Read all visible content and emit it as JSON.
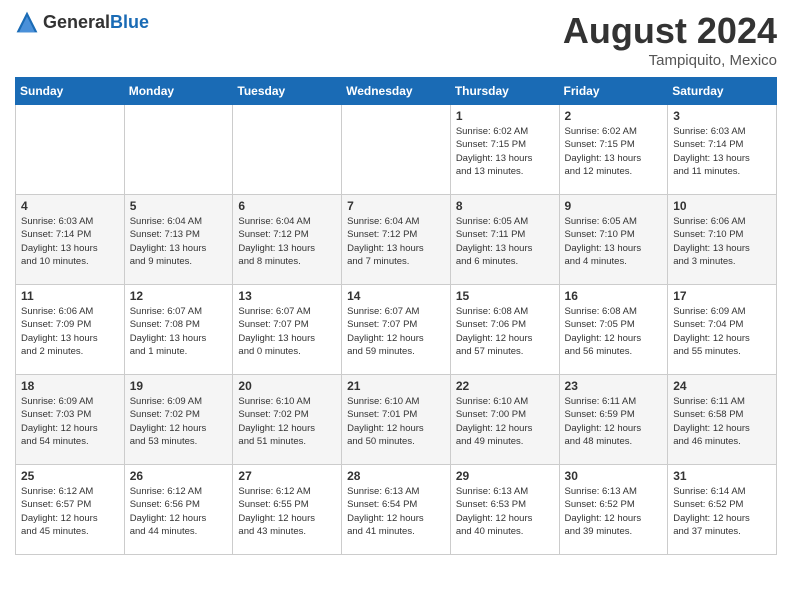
{
  "header": {
    "logo_general": "General",
    "logo_blue": "Blue",
    "month_year": "August 2024",
    "location": "Tampiquito, Mexico"
  },
  "calendar": {
    "days_of_week": [
      "Sunday",
      "Monday",
      "Tuesday",
      "Wednesday",
      "Thursday",
      "Friday",
      "Saturday"
    ],
    "weeks": [
      [
        {
          "day": "",
          "info": ""
        },
        {
          "day": "",
          "info": ""
        },
        {
          "day": "",
          "info": ""
        },
        {
          "day": "",
          "info": ""
        },
        {
          "day": "1",
          "info": "Sunrise: 6:02 AM\nSunset: 7:15 PM\nDaylight: 13 hours\nand 13 minutes."
        },
        {
          "day": "2",
          "info": "Sunrise: 6:02 AM\nSunset: 7:15 PM\nDaylight: 13 hours\nand 12 minutes."
        },
        {
          "day": "3",
          "info": "Sunrise: 6:03 AM\nSunset: 7:14 PM\nDaylight: 13 hours\nand 11 minutes."
        }
      ],
      [
        {
          "day": "4",
          "info": "Sunrise: 6:03 AM\nSunset: 7:14 PM\nDaylight: 13 hours\nand 10 minutes."
        },
        {
          "day": "5",
          "info": "Sunrise: 6:04 AM\nSunset: 7:13 PM\nDaylight: 13 hours\nand 9 minutes."
        },
        {
          "day": "6",
          "info": "Sunrise: 6:04 AM\nSunset: 7:12 PM\nDaylight: 13 hours\nand 8 minutes."
        },
        {
          "day": "7",
          "info": "Sunrise: 6:04 AM\nSunset: 7:12 PM\nDaylight: 13 hours\nand 7 minutes."
        },
        {
          "day": "8",
          "info": "Sunrise: 6:05 AM\nSunset: 7:11 PM\nDaylight: 13 hours\nand 6 minutes."
        },
        {
          "day": "9",
          "info": "Sunrise: 6:05 AM\nSunset: 7:10 PM\nDaylight: 13 hours\nand 4 minutes."
        },
        {
          "day": "10",
          "info": "Sunrise: 6:06 AM\nSunset: 7:10 PM\nDaylight: 13 hours\nand 3 minutes."
        }
      ],
      [
        {
          "day": "11",
          "info": "Sunrise: 6:06 AM\nSunset: 7:09 PM\nDaylight: 13 hours\nand 2 minutes."
        },
        {
          "day": "12",
          "info": "Sunrise: 6:07 AM\nSunset: 7:08 PM\nDaylight: 13 hours\nand 1 minute."
        },
        {
          "day": "13",
          "info": "Sunrise: 6:07 AM\nSunset: 7:07 PM\nDaylight: 13 hours\nand 0 minutes."
        },
        {
          "day": "14",
          "info": "Sunrise: 6:07 AM\nSunset: 7:07 PM\nDaylight: 12 hours\nand 59 minutes."
        },
        {
          "day": "15",
          "info": "Sunrise: 6:08 AM\nSunset: 7:06 PM\nDaylight: 12 hours\nand 57 minutes."
        },
        {
          "day": "16",
          "info": "Sunrise: 6:08 AM\nSunset: 7:05 PM\nDaylight: 12 hours\nand 56 minutes."
        },
        {
          "day": "17",
          "info": "Sunrise: 6:09 AM\nSunset: 7:04 PM\nDaylight: 12 hours\nand 55 minutes."
        }
      ],
      [
        {
          "day": "18",
          "info": "Sunrise: 6:09 AM\nSunset: 7:03 PM\nDaylight: 12 hours\nand 54 minutes."
        },
        {
          "day": "19",
          "info": "Sunrise: 6:09 AM\nSunset: 7:02 PM\nDaylight: 12 hours\nand 53 minutes."
        },
        {
          "day": "20",
          "info": "Sunrise: 6:10 AM\nSunset: 7:02 PM\nDaylight: 12 hours\nand 51 minutes."
        },
        {
          "day": "21",
          "info": "Sunrise: 6:10 AM\nSunset: 7:01 PM\nDaylight: 12 hours\nand 50 minutes."
        },
        {
          "day": "22",
          "info": "Sunrise: 6:10 AM\nSunset: 7:00 PM\nDaylight: 12 hours\nand 49 minutes."
        },
        {
          "day": "23",
          "info": "Sunrise: 6:11 AM\nSunset: 6:59 PM\nDaylight: 12 hours\nand 48 minutes."
        },
        {
          "day": "24",
          "info": "Sunrise: 6:11 AM\nSunset: 6:58 PM\nDaylight: 12 hours\nand 46 minutes."
        }
      ],
      [
        {
          "day": "25",
          "info": "Sunrise: 6:12 AM\nSunset: 6:57 PM\nDaylight: 12 hours\nand 45 minutes."
        },
        {
          "day": "26",
          "info": "Sunrise: 6:12 AM\nSunset: 6:56 PM\nDaylight: 12 hours\nand 44 minutes."
        },
        {
          "day": "27",
          "info": "Sunrise: 6:12 AM\nSunset: 6:55 PM\nDaylight: 12 hours\nand 43 minutes."
        },
        {
          "day": "28",
          "info": "Sunrise: 6:13 AM\nSunset: 6:54 PM\nDaylight: 12 hours\nand 41 minutes."
        },
        {
          "day": "29",
          "info": "Sunrise: 6:13 AM\nSunset: 6:53 PM\nDaylight: 12 hours\nand 40 minutes."
        },
        {
          "day": "30",
          "info": "Sunrise: 6:13 AM\nSunset: 6:52 PM\nDaylight: 12 hours\nand 39 minutes."
        },
        {
          "day": "31",
          "info": "Sunrise: 6:14 AM\nSunset: 6:52 PM\nDaylight: 12 hours\nand 37 minutes."
        }
      ]
    ]
  }
}
